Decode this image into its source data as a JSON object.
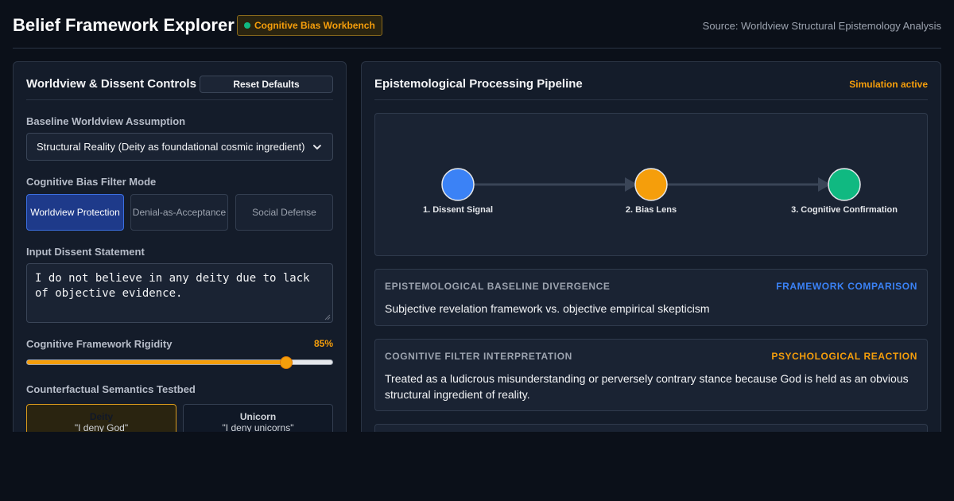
{
  "header": {
    "title": "Belief Framework Explorer",
    "badge": "Cognitive Bias Workbench",
    "source": "Source: Worldview Structural Epistemology Analysis"
  },
  "controls": {
    "title": "Worldview & Dissent Controls",
    "reset_label": "Reset Defaults",
    "baseline_label": "Baseline Worldview Assumption",
    "baseline_value": "Structural Reality (Deity as foundational cosmic ingredient)",
    "filter_label": "Cognitive Bias Filter Mode",
    "filter_modes": [
      {
        "label": "Worldview Protection",
        "active": true
      },
      {
        "label": "Denial-as-Acceptance",
        "active": false
      },
      {
        "label": "Social Defense",
        "active": false
      }
    ],
    "dissent_label": "Input Dissent Statement",
    "dissent_value": "I do not believe in any deity due to lack of objective evidence.",
    "rigidity_label": "Cognitive Framework Rigidity",
    "rigidity_display": "85%",
    "rigidity_value": 85,
    "counterfactual_label": "Counterfactual Semantics Testbed",
    "counterfactuals": [
      {
        "name": "Deity",
        "quote": "\"I deny God\""
      },
      {
        "name": "Unicorn",
        "quote": "\"I deny unicorns\""
      }
    ]
  },
  "pipeline": {
    "title": "Epistemological Processing Pipeline",
    "status": "Simulation active",
    "nodes": [
      {
        "label": "1. Dissent Signal",
        "color": "#3b82f6"
      },
      {
        "label": "2. Bias Lens",
        "color": "#f59e0b"
      },
      {
        "label": "3. Cognitive Confirmation",
        "color": "#10b981"
      }
    ],
    "cards": [
      {
        "heading": "EPISTEMOLOGICAL BASELINE DIVERGENCE",
        "tag": "FRAMEWORK COMPARISON",
        "tag_color": "#3b82f6",
        "body": "Subjective revelation framework vs. objective empirical skepticism"
      },
      {
        "heading": "COGNITIVE FILTER INTERPRETATION",
        "tag": "PSYCHOLOGICAL REACTION",
        "tag_color": "#f59e0b",
        "body": "Treated as a ludicrous misunderstanding or perversely contrary stance because God is held as an obvious structural ingredient of reality."
      }
    ]
  },
  "colors": {
    "accent": "#f59e0b",
    "primary": "#3b82f6",
    "success": "#10b981"
  }
}
